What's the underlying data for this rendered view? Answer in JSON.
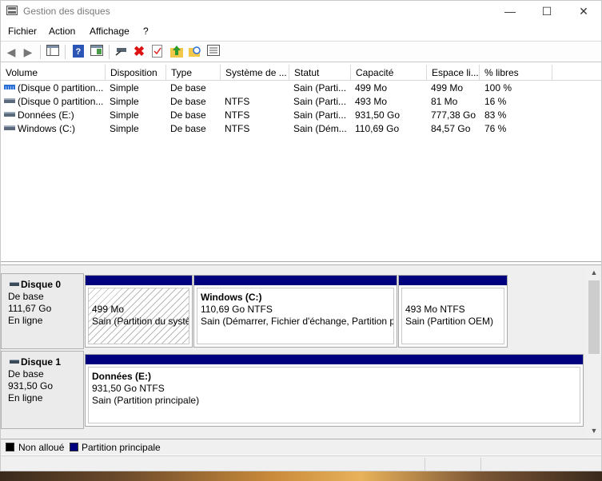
{
  "window": {
    "title": "Gestion des disques",
    "controls": {
      "minimize": "—",
      "maximize": "☐",
      "close": "✕"
    }
  },
  "menu": [
    "Fichier",
    "Action",
    "Affichage",
    "?"
  ],
  "toolbar": {
    "icons": [
      "back-arrow",
      "forward-arrow",
      "console-tree",
      "help",
      "action-pane",
      "connect-disk",
      "delete",
      "properties",
      "up-folder",
      "search-folder",
      "list-view"
    ]
  },
  "volume_list": {
    "columns": [
      "Volume",
      "Disposition",
      "Type",
      "Système de ...",
      "Statut",
      "Capacité",
      "Espace li...",
      "% libres"
    ],
    "rows": [
      {
        "volume": "(Disque 0 partition...",
        "disposition": "Simple",
        "type": "De base",
        "fs": "",
        "status": "Sain (Parti...",
        "capacity": "499 Mo",
        "free": "499 Mo",
        "pct": "100 %",
        "icon": "striped"
      },
      {
        "volume": "(Disque 0 partition...",
        "disposition": "Simple",
        "type": "De base",
        "fs": "NTFS",
        "status": "Sain (Parti...",
        "capacity": "493 Mo",
        "free": "81 Mo",
        "pct": "16 %",
        "icon": "plain"
      },
      {
        "volume": "Données (E:)",
        "disposition": "Simple",
        "type": "De base",
        "fs": "NTFS",
        "status": "Sain (Parti...",
        "capacity": "931,50 Go",
        "free": "777,38 Go",
        "pct": "83 %",
        "icon": "plain"
      },
      {
        "volume": "Windows (C:)",
        "disposition": "Simple",
        "type": "De base",
        "fs": "NTFS",
        "status": "Sain (Dém...",
        "capacity": "110,69 Go",
        "free": "84,57 Go",
        "pct": "76 %",
        "icon": "plain"
      }
    ]
  },
  "disks": [
    {
      "name": "Disque 0",
      "kind": "De base",
      "size": "111,67 Go",
      "state": "En ligne",
      "partitions": [
        {
          "title": "",
          "line1": "499 Mo",
          "line2": "Sain (Partition du systè",
          "hatched": true
        },
        {
          "title": "Windows  (C:)",
          "line1": "110,69 Go NTFS",
          "line2": "Sain (Démarrer, Fichier d'échange, Partition p",
          "hatched": false
        },
        {
          "title": "",
          "line1": "493 Mo NTFS",
          "line2": "Sain (Partition OEM)",
          "hatched": false
        }
      ]
    },
    {
      "name": "Disque 1",
      "kind": "De base",
      "size": "931,50 Go",
      "state": "En ligne",
      "partitions": [
        {
          "title": "Données  (E:)",
          "line1": "931,50 Go NTFS",
          "line2": "Sain (Partition principale)",
          "hatched": false
        }
      ]
    }
  ],
  "legend": {
    "unallocated": {
      "label": "Non alloué",
      "color": "#000000"
    },
    "primary": {
      "label": "Partition principale",
      "color": "#00007f"
    }
  }
}
